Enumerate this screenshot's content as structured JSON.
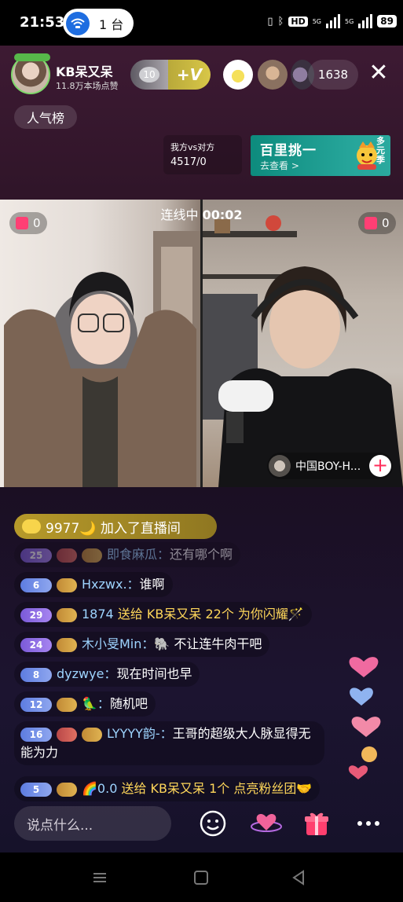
{
  "status_bar": {
    "time": "21:53",
    "hotspot_label": "1 台",
    "hd_label": "HD",
    "network_label": "5G",
    "battery": "89"
  },
  "header": {
    "host_name": "KB呆又呆",
    "host_likes": "11.8万本场点赞",
    "heart_count": "10",
    "vplus_label": "+V",
    "viewer_count": "1638",
    "close_label": "✕"
  },
  "rank": {
    "label": "人气榜"
  },
  "pk": {
    "label": "我方vs对方",
    "score": "4517/0"
  },
  "banner": {
    "title": "百里挑一",
    "subtitle": "去查看 >",
    "side_text": "多元季"
  },
  "video": {
    "link_label": "连线中",
    "link_time": "00:02",
    "left_score": "0",
    "right_score": "0",
    "guest_name": "中国BOY-H..."
  },
  "join": {
    "text": "9977🌙 加入了直播间"
  },
  "chat": [
    {
      "level": "25",
      "name": "即食麻瓜：",
      "text": "还有哪个啊",
      "faded": true
    },
    {
      "level": "6",
      "name": "Hxzwx.：",
      "text": "谁啊"
    },
    {
      "level": "29",
      "name": "1874",
      "gift": "送给 KB呆又呆 22个 为你闪耀🪄"
    },
    {
      "level": "24",
      "name": "木小旻Min：",
      "text": "🐘 不让连牛肉干吧"
    },
    {
      "level": "8",
      "name": "dyzwye：",
      "text": "现在时间也早"
    },
    {
      "level": "12",
      "name": "🦜：",
      "text": "随机吧"
    },
    {
      "level": "16",
      "name": "LYYYY韵-：",
      "text": "王哥的超级大人脉显得无能为力"
    },
    {
      "level": "5",
      "name": "🌈0.0",
      "gift": "送给 KB呆又呆 1个 点亮粉丝团🤝"
    }
  ],
  "input": {
    "placeholder": "说点什么..."
  },
  "icons": {
    "emoji": "emoji-icon",
    "heart_planet": "heart-planet-icon",
    "gift": "gift-icon",
    "more": "more-icon"
  },
  "colors": {
    "accent_pink": "#ff3f74",
    "gift_yellow": "#ffd75a",
    "username_blue": "#9ed4ff"
  }
}
